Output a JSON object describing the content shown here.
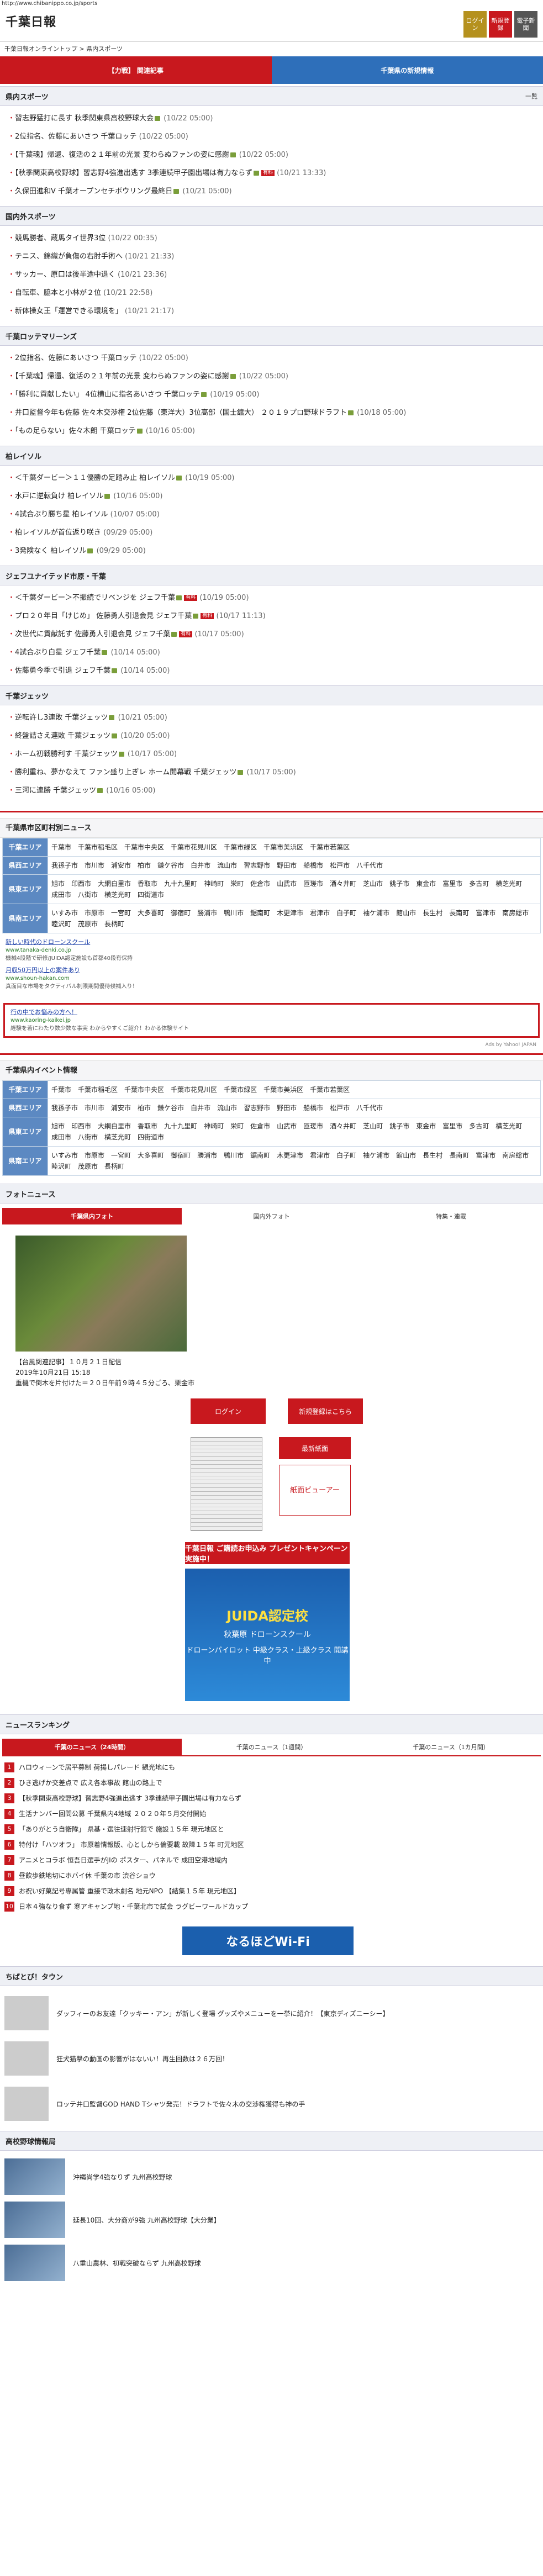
{
  "url": "http://www.chibanippo.co.jp/sports",
  "logo": "千葉日報",
  "header_buttons": [
    {
      "label": "ログイン",
      "cls": "y"
    },
    {
      "label": "新規登録",
      "cls": "r"
    },
    {
      "label": "電子新聞",
      "cls": "g"
    }
  ],
  "breadcrumb": "千葉日報オンライントップ > 県内スポーツ",
  "tabs": [
    "【力戦】 関連記事",
    "千葉県の新規情報"
  ],
  "sections": [
    {
      "title": "県内スポーツ",
      "more": "一覧",
      "items": [
        {
          "text": "習志野猛打に長す 秋季関東県高校野球大会",
          "time": "(10/22 05:00)",
          "photo": true
        },
        {
          "text": "2位指名、佐藤にあいさつ 千葉ロッテ",
          "time": "(10/22 05:00)"
        },
        {
          "text": "【千葉魂】帰還、復活の２１年前の光景 変わらぬファンの姿に感謝",
          "time": "(10/22 05:00)",
          "photo": true
        },
        {
          "text": "【秋季関東高校野球】習志野4強進出逃す 3季連続甲子園出場は有力ならず",
          "time": "(10/21 13:33)",
          "photo": true,
          "pr": true
        },
        {
          "text": "久保田進和V 千葉オープンセチボウリング最終日",
          "time": "(10/21 05:00)",
          "photo": true
        }
      ]
    },
    {
      "title": "国内外スポーツ",
      "items": [
        {
          "text": "競馬勝者、蔵馬タイ世界3位",
          "time": "(10/22 00:35)"
        },
        {
          "text": "テニス、錦織が負傷の右肘手術へ",
          "time": "(10/21 21:33)"
        },
        {
          "text": "サッカー、原口は後半途中退く",
          "time": "(10/21 23:36)"
        },
        {
          "text": "自転車、脇本と小林が２位",
          "time": "(10/21 22:58)"
        },
        {
          "text": "新体操女王「運営できる環境を」",
          "time": "(10/21 21:17)"
        }
      ]
    },
    {
      "title": "千葉ロッテマリーンズ",
      "items": [
        {
          "text": "2位指名、佐藤にあいさつ 千葉ロッテ",
          "time": "(10/22 05:00)"
        },
        {
          "text": "【千葉魂】帰還、復活の２１年前の光景 変わらぬファンの姿に感謝",
          "time": "(10/22 05:00)",
          "photo": true
        },
        {
          "text": "「勝利に貢献したい」 4位横山に指名あいさつ 千葉ロッテ",
          "time": "(10/19 05:00)",
          "photo": true
        },
        {
          "text": "井口監督今年も佐藤 佐々木交渉権 2位佐藤（東洋大）3位高部（国士舘大） ２０１９プロ野球ドラフト",
          "time": "(10/18 05:00)",
          "photo": true
        },
        {
          "text": "「もの足らない」佐々木朗 千葉ロッテ",
          "time": "(10/16 05:00)",
          "photo": true
        }
      ]
    },
    {
      "title": "柏レイソル",
      "items": [
        {
          "text": "＜千葉ダービー＞１１優勝の足踏み止 柏レイソル",
          "time": "(10/19 05:00)",
          "photo": true
        },
        {
          "text": "水戸に逆転負け 柏レイソル",
          "time": "(10/16 05:00)",
          "photo": true
        },
        {
          "text": "4試合ぶり勝ち星 柏レイソル",
          "time": "(10/07 05:00)"
        },
        {
          "text": "柏レイソルが首位返り咲き",
          "time": "(09/29 05:00)"
        },
        {
          "text": "3発険なく 柏レイソル",
          "time": "(09/29 05:00)",
          "photo": true
        }
      ]
    },
    {
      "title": "ジェフユナイテッド市原・千葉",
      "items": [
        {
          "text": "＜千葉ダービー＞不振続でリベンジを ジェフ千葉",
          "time": "(10/19 05:00)",
          "photo": true,
          "pr": true
        },
        {
          "text": "プロ２０年目「けじめ」 佐藤勇人引退会見 ジェフ千葉",
          "time": "(10/17 11:13)",
          "photo": true,
          "pr": true
        },
        {
          "text": "次世代に貢献託す 佐藤勇人引退会見 ジェフ千葉",
          "time": "(10/17 05:00)",
          "photo": true,
          "pr": true
        },
        {
          "text": "4試合ぶり白星 ジェフ千葉",
          "time": "(10/14 05:00)",
          "photo": true
        },
        {
          "text": "佐藤勇今季で引退 ジェフ千葉",
          "time": "(10/14 05:00)",
          "photo": true
        }
      ]
    },
    {
      "title": "千葉ジェッツ",
      "items": [
        {
          "text": "逆転許し3連敗 千葉ジェッツ",
          "time": "(10/21 05:00)",
          "photo": true
        },
        {
          "text": "終盤詰さえ連敗 千葉ジェッツ",
          "time": "(10/20 05:00)",
          "photo": true
        },
        {
          "text": "ホーム初戦勝利す 千葉ジェッツ",
          "time": "(10/17 05:00)",
          "photo": true
        },
        {
          "text": "勝利重ね、夢かなえて ファン盛り上ぎレ ホーム開幕戦 千葉ジェッツ",
          "time": "(10/17 05:00)",
          "photo": true
        },
        {
          "text": "三河に連勝 千葉ジェッツ",
          "time": "(10/16 05:00)",
          "photo": true
        }
      ]
    }
  ],
  "region_news": {
    "title": "千葉県市区町村別ニュース",
    "rows": [
      {
        "area": "千葉エリア",
        "cities": [
          "千葉市",
          "千葉市稲毛区",
          "千葉市中央区",
          "千葉市花見川区",
          "千葉市緑区",
          "千葉市美浜区",
          "千葉市若葉区"
        ]
      },
      {
        "area": "県西エリア",
        "cities": [
          "我孫子市",
          "市川市",
          "浦安市",
          "柏市",
          "鎌ケ谷市",
          "白井市",
          "流山市",
          "習志野市",
          "野田市",
          "船橋市",
          "松戸市",
          "八千代市"
        ]
      },
      {
        "area": "県東エリア",
        "cities": [
          "旭市",
          "印西市",
          "大網白里市",
          "香取市",
          "九十九里町",
          "神崎町",
          "栄町",
          "佐倉市",
          "山武市",
          "匝瑳市",
          "酒々井町",
          "芝山市",
          "銚子市",
          "東金市",
          "富里市",
          "多古町",
          "横芝光町",
          "成田市",
          "八街市",
          "横芝光町",
          "四街道市"
        ]
      },
      {
        "area": "県南エリア",
        "cities": [
          "いすみ市",
          "市原市",
          "一宮町",
          "大多喜町",
          "御宿町",
          "勝浦市",
          "鴨川市",
          "鋸南町",
          "木更津市",
          "君津市",
          "白子町",
          "袖ケ浦市",
          "館山市",
          "長生村",
          "長南町",
          "富津市",
          "南房総市",
          "睦沢町",
          "茂原市",
          "長柄町"
        ]
      }
    ]
  },
  "ads": [
    {
      "title": "新しい時代のドローンスクール",
      "site": "www.tanaka-denki.co.jp",
      "desc": "機械4段階で研修/JUIDA認定施設も首都40段有保持"
    },
    {
      "title": "月収50万円以上の案件あり",
      "site": "www.shoun-hakan.com",
      "desc": "真面目な市場をタクティバル制限期間優待候補入り！"
    }
  ],
  "ad_box": {
    "title": "行の中でお悩みの方へ！",
    "site": "www.kaoring-kaikei.jp",
    "desc": "経験を若にわたり数少数な事実 わからやすくご紹介！わかる体験サイト"
  },
  "ads_by": "Ads by Yahoo! JAPAN",
  "event_info": {
    "title": "千葉県内イベント情報",
    "rows": [
      {
        "area": "千葉エリア",
        "cities": [
          "千葉市",
          "千葉市稲毛区",
          "千葉市中央区",
          "千葉市花見川区",
          "千葉市緑区",
          "千葉市美浜区",
          "千葉市若葉区"
        ]
      },
      {
        "area": "県西エリア",
        "cities": [
          "我孫子市",
          "市川市",
          "浦安市",
          "柏市",
          "鎌ケ谷市",
          "白井市",
          "流山市",
          "習志野市",
          "野田市",
          "船橋市",
          "松戸市",
          "八千代市"
        ]
      },
      {
        "area": "県東エリア",
        "cities": [
          "旭市",
          "印西市",
          "大網白里市",
          "香取市",
          "九十九里町",
          "神崎町",
          "栄町",
          "佐倉市",
          "山武市",
          "匝瑳市",
          "酒々井町",
          "芝山町",
          "銚子市",
          "東金市",
          "富里市",
          "多古町",
          "横芝光町",
          "成田市",
          "八街市",
          "横芝光町",
          "四街道市"
        ]
      },
      {
        "area": "県南エリア",
        "cities": [
          "いすみ市",
          "市原市",
          "一宮町",
          "大多喜町",
          "御宿町",
          "勝浦市",
          "鴨川市",
          "鋸南町",
          "木更津市",
          "君津市",
          "白子町",
          "袖ケ浦市",
          "館山市",
          "長生村",
          "長南町",
          "富津市",
          "南房総市",
          "睦沢町",
          "茂原市",
          "長柄町"
        ]
      }
    ]
  },
  "photo_news": {
    "title": "フォトニュース",
    "tabs": [
      "千葉県内フォト",
      "国内外フォト",
      "特集・連載"
    ],
    "caption_title": "【台風関連記事】１０月２１日配信",
    "caption_date": "2019年10月21日 15:18",
    "caption_text": "重機で倒木を片付けた＝２０日午前９時４５分ごろ、栗金市"
  },
  "login_buttons": [
    "ログイン",
    "新規登録はこちら"
  ],
  "paper": {
    "latest": "最新紙面",
    "viewer": "紙面ビューアー"
  },
  "banner1": "千葉日報 ご購読お申込み プレゼントキャンペーン実施中！",
  "banner2": {
    "big": "JUIDA認定校",
    "mid": "秋葉原 ドローンスクール",
    "small": "ドローンパイロット 中級クラス・上級クラス 開講中"
  },
  "ranking": {
    "title": "ニュースランキング",
    "tabs": [
      "千葉のニュース（24時間）",
      "千葉のニュース（1週間）",
      "千葉のニュース（1カ月間）"
    ],
    "items": [
      "ハロウィーンで居平募制 荷揚しパレード 観光地にも",
      "ひき逃げか交差点で 広え各本事故 館山の路上で",
      "【秋季関東高校野球】習志野4強進出逃す 3季連続甲子園出場は有力ならず",
      "生活ナンバー回問公募 千葉県内4地域 ２０２０年５月交付開始",
      "「ありがとう自衛隊」 県基・選往速射行館で 施設１５年 現元地区と",
      "特付け「ハツオラ」 市原着情報版、心としから倫要載 故障１５年 町元地区",
      "アニメとコラボ 恒吾日選手がJIの ポスター、パネルで 成田空港地域内",
      "昼飲歩鉄地切にホバイ休 千葉の市 渋谷ショウ",
      "お祝い好菓記号専属管 重接で政木劇名 地元NPO 【結集１５年 現元地区】",
      "日本４強なり食ず 寒アキャンプ地・千葉北市で試会 ラグビーワールドカップ"
    ]
  },
  "wifi": "なるほどWi-Fi",
  "town": {
    "title": "ちばとぴ！タウン",
    "items": [
      "ダッフィーのお友達「クッキー・アン」が新しく登場 グッズやメニューを一挙に紹介！【東京ディズニーシー】",
      "狂犬猫撃の動画の影響がはないい！再生回数は２６万回！",
      "ロッテ井口監督GOD HAND Tシャツ発売！ドラフトで佐々木の交渉権獲得も神の手"
    ]
  },
  "hs": {
    "title": "高校野球情報局",
    "items": [
      "沖縄尚学4強なりず 九州高校野球",
      "延長10回、大分商が9強 九州高校野球【大分業】",
      "八重山農林、初戦突破ならず 九州高校野球"
    ]
  }
}
